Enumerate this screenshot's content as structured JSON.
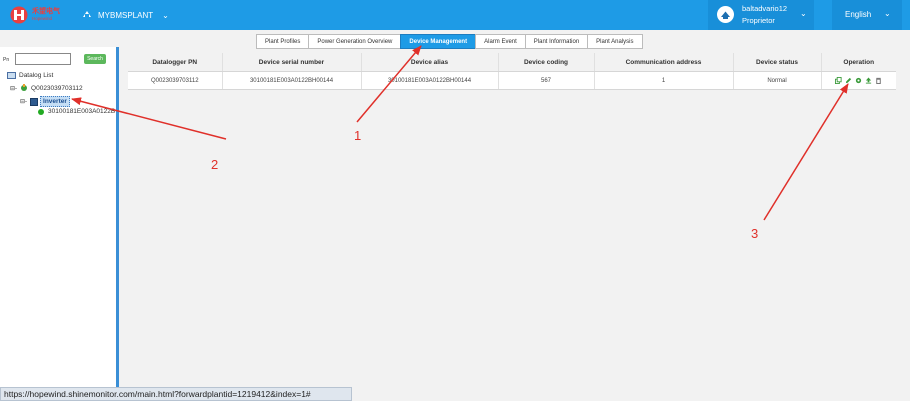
{
  "header": {
    "logo_text_cn": "禾望电气",
    "logo_text_en": "Hopewind",
    "plant_name": "MYBMSPLANT",
    "user_name": "baltadvario12",
    "user_role": "Proprietor",
    "language": "English"
  },
  "tabs": [
    {
      "label": "Plant Profiles",
      "active": false
    },
    {
      "label": "Power Generation Overview",
      "active": false
    },
    {
      "label": "Device Management",
      "active": true
    },
    {
      "label": "Alarm Event",
      "active": false
    },
    {
      "label": "Plant Information",
      "active": false
    },
    {
      "label": "Plant Analysis",
      "active": false
    }
  ],
  "sidebar": {
    "sn_label": "Pn",
    "sn_input_value": "",
    "search_label": "Search",
    "tree": {
      "root_label": "Datalog List",
      "datalogger": "Q0023039703112",
      "inverter": "Inverter",
      "device": "30100181E003A0122B"
    }
  },
  "table": {
    "columns": [
      "Datalogger PN",
      "Device serial number",
      "Device alias",
      "Device coding",
      "Communication address",
      "Device status",
      "Operation"
    ],
    "rows": [
      {
        "pn": "Q0023039703112",
        "serial": "30100181E003A0122BH00144",
        "alias": "30100181E003A0122BH00144",
        "coding": "567",
        "address": "1",
        "status": "Normal"
      }
    ]
  },
  "status_url": "https://hopewind.shinemonitor.com/main.html?forwardplantid=1219412&index=1#",
  "annotations": [
    "1",
    "2",
    "3"
  ],
  "colors": {
    "header_blue": "#1e9be6",
    "annotation_red": "#e0302a",
    "status_green": "#22aa22"
  }
}
